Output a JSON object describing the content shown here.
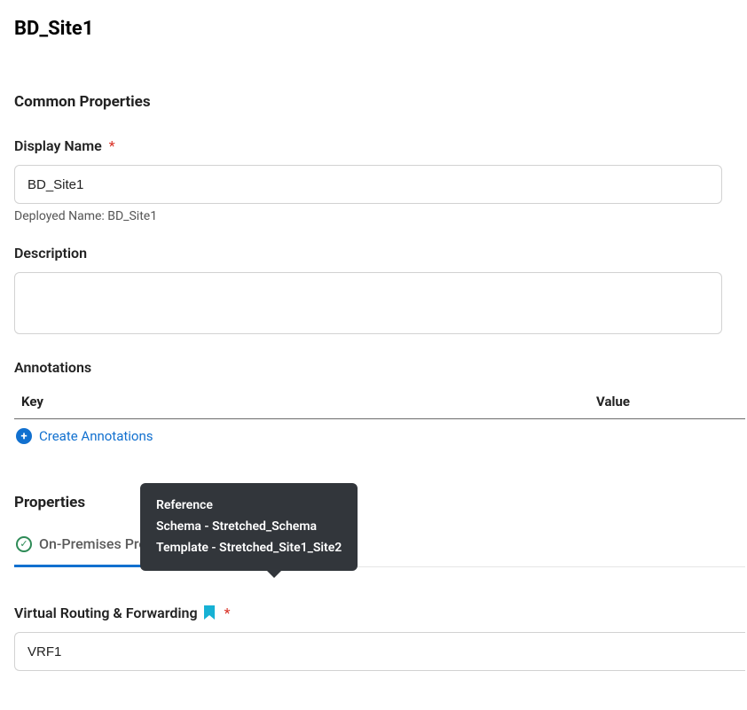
{
  "page_title": "BD_Site1",
  "common_properties": {
    "heading": "Common Properties",
    "display_name": {
      "label": "Display Name",
      "value": "BD_Site1",
      "deployed_name_prefix": "Deployed Name: ",
      "deployed_name": "BD_Site1"
    },
    "description": {
      "label": "Description",
      "value": ""
    },
    "annotations": {
      "label": "Annotations",
      "key_header": "Key",
      "value_header": "Value",
      "create_label": "Create Annotations"
    }
  },
  "properties": {
    "heading": "Properties",
    "tab_label": "On-Premises Properties",
    "tooltip": {
      "line1": "Reference",
      "line2": "Schema - Stretched_Schema",
      "line3": "Template - Stretched_Site1_Site2"
    },
    "vrf": {
      "label": "Virtual Routing & Forwarding",
      "value": "VRF1"
    }
  }
}
